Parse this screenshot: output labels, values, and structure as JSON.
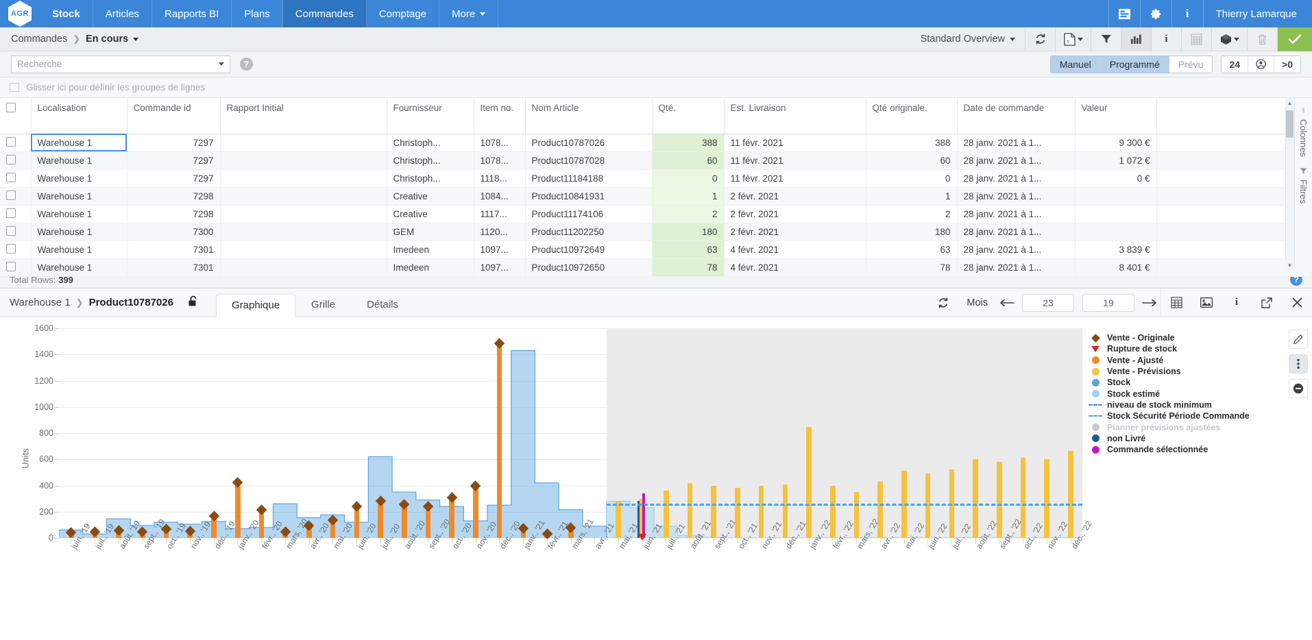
{
  "topnav": {
    "logo": "AGR",
    "items": [
      {
        "label": "Stock",
        "state": "bold"
      },
      {
        "label": "Articles",
        "state": "normal"
      },
      {
        "label": "Rapports BI",
        "state": "normal"
      },
      {
        "label": "Plans",
        "state": "normal"
      },
      {
        "label": "Commandes",
        "state": "active"
      },
      {
        "label": "Comptage",
        "state": "normal"
      },
      {
        "label": "More",
        "state": "caret"
      }
    ],
    "icons": [
      "list-icon",
      "gear-icon",
      "info-icon"
    ],
    "user": "Thierry Lamarque"
  },
  "breadcrumb": {
    "root": "Commandes",
    "current": "En cours",
    "overview": "Standard Overview",
    "tools": [
      "refresh-icon",
      "excel-export-icon",
      "filter-icon",
      "chart-icon",
      "info-icon",
      "calculator-icon",
      "cube-icon",
      "trash-icon",
      "confirm-icon"
    ]
  },
  "search": {
    "placeholder": "Recherche",
    "help": "?",
    "segments": [
      {
        "label": "Manuel",
        "on": true
      },
      {
        "label": "Programmé",
        "on": true
      },
      {
        "label": "Prévu",
        "on": false
      }
    ],
    "counter": "24",
    "user_icon": "user-icon",
    "threshold": ">0"
  },
  "grouping": {
    "hint": "Glisser ici pour définir les groupes de lignes"
  },
  "grid": {
    "columns": [
      "Localisation",
      "Commande id",
      "Rapport Initial",
      "Fournisseur",
      "Item no.",
      "Nom Article",
      "Qté.",
      "Est. Livraison",
      "Qté originale.",
      "Date de commande",
      "Valeur"
    ],
    "rows": [
      {
        "loc": "Warehouse 1",
        "cid": "7297",
        "rapport": "",
        "fourn": "Christoph...",
        "item": "1078...",
        "nom": "Product10787026",
        "qte": "388",
        "liv": "11 févr. 2021",
        "qteo": "388",
        "date": "28 janv. 2021 à 1...",
        "val": "9 300 €"
      },
      {
        "loc": "Warehouse 1",
        "cid": "7297",
        "rapport": "",
        "fourn": "Christoph...",
        "item": "1078...",
        "nom": "Product10787028",
        "qte": "60",
        "liv": "11 févr. 2021",
        "qteo": "60",
        "date": "28 janv. 2021 à 1...",
        "val": "1 072 €"
      },
      {
        "loc": "Warehouse 1",
        "cid": "7297",
        "rapport": "",
        "fourn": "Christoph...",
        "item": "1118...",
        "nom": "Product11184188",
        "qte": "0",
        "liv": "11 févr. 2021",
        "qteo": "0",
        "date": "28 janv. 2021 à 1...",
        "val": "0 €"
      },
      {
        "loc": "Warehouse 1",
        "cid": "7298",
        "rapport": "",
        "fourn": "Creative",
        "item": "1084...",
        "nom": "Product10841931",
        "qte": "1",
        "liv": "2 févr. 2021",
        "qteo": "1",
        "date": "28 janv. 2021 à 1...",
        "val": ""
      },
      {
        "loc": "Warehouse 1",
        "cid": "7298",
        "rapport": "",
        "fourn": "Creative",
        "item": "1117...",
        "nom": "Product11174106",
        "qte": "2",
        "liv": "2 févr. 2021",
        "qteo": "2",
        "date": "28 janv. 2021 à 1...",
        "val": ""
      },
      {
        "loc": "Warehouse 1",
        "cid": "7300",
        "rapport": "",
        "fourn": "GEM",
        "item": "1120...",
        "nom": "Product11202250",
        "qte": "180",
        "liv": "2 févr. 2021",
        "qteo": "180",
        "date": "28 janv. 2021 à 1...",
        "val": ""
      },
      {
        "loc": "Warehouse 1",
        "cid": "7301",
        "rapport": "",
        "fourn": "Imedeen",
        "item": "1097...",
        "nom": "Product10972649",
        "qte": "63",
        "liv": "4 févr. 2021",
        "qteo": "63",
        "date": "28 janv. 2021 à 1...",
        "val": "3 839 €"
      },
      {
        "loc": "Warehouse 1",
        "cid": "7301",
        "rapport": "",
        "fourn": "Imedeen",
        "item": "1097...",
        "nom": "Product10972650",
        "qte": "78",
        "liv": "4 févr. 2021",
        "qteo": "78",
        "date": "28 janv. 2021 à 1...",
        "val": "8 401 €"
      }
    ],
    "rail": [
      "Colonnes",
      "Filtres"
    ]
  },
  "totals": {
    "label": "Total Rows:",
    "value": "399"
  },
  "detail": {
    "warehouse": "Warehouse 1",
    "product": "Product10787026",
    "lock_icon": "unlock-icon",
    "tabs": [
      {
        "label": "Graphique",
        "on": true
      },
      {
        "label": "Grille",
        "on": false
      },
      {
        "label": "Détails",
        "on": false
      }
    ],
    "refresh_icon": "refresh-icon",
    "period_label": "Mois",
    "back_arrow": "arrow-left-icon",
    "months_back": "23",
    "months_fwd": "19",
    "fwd_arrow": "arrow-right-icon",
    "tools": [
      "grid-icon",
      "image-icon",
      "info-icon",
      "popout-icon",
      "close-icon"
    ],
    "side_tools": [
      "edit-icon",
      "more-icon",
      "minus-icon"
    ]
  },
  "chart_data": {
    "type": "bar",
    "title": "",
    "xlabel": "",
    "ylabel": "Units",
    "ylim": [
      0,
      1600
    ],
    "yticks": [
      0,
      200,
      400,
      600,
      800,
      1000,
      1200,
      1400,
      1600
    ],
    "grid": true,
    "legend_position": "right",
    "forecast_start_index": 23,
    "min_stock_level": 0,
    "safety_stock_order_period": 262,
    "categories": [
      "juin, '19",
      "juil., '19",
      "août, '19",
      "sept., '19",
      "oct., '19",
      "nov., '19",
      "déc., '19",
      "janv., '20",
      "févr., '20",
      "mars, '20",
      "avr., '20",
      "mai, '20",
      "juin, '20",
      "juil., '20",
      "août, '20",
      "sept., '20",
      "oct., '20",
      "nov., '20",
      "déc., '20",
      "janv., '21",
      "févr., '21",
      "mars, '21",
      "avr., '21",
      "mai, '21",
      "juin, '21",
      "juil., '21",
      "août, '21",
      "sept., '21",
      "oct., '21",
      "nov., '21",
      "déc., '21",
      "janv., '22",
      "févr., '22",
      "mars, '22",
      "avr., '22",
      "mai, '22",
      "juin, '22",
      "juil., '22",
      "août, '22",
      "sept., '22",
      "oct., '22",
      "nov., '22",
      "déc., '22"
    ],
    "series": [
      {
        "name": "Vente - Originale",
        "type": "diamond-marker",
        "color": "#8a4b12",
        "values": [
          35,
          40,
          52,
          38,
          62,
          45,
          160,
          415,
          205,
          40,
          85,
          130,
          235,
          275,
          250,
          232,
          300,
          390,
          1475,
          65,
          25,
          70,
          null,
          null,
          null,
          null,
          null,
          null,
          null,
          null,
          null,
          null,
          null,
          null,
          null,
          null,
          null,
          null,
          null,
          null,
          null,
          null,
          null
        ]
      },
      {
        "name": "Rupture de stock",
        "type": "triangle-marker",
        "color": "#e02020",
        "values": [
          null,
          null,
          null,
          null,
          null,
          null,
          null,
          null,
          null,
          null,
          null,
          null,
          null,
          null,
          null,
          null,
          null,
          null,
          null,
          null,
          null,
          null,
          null,
          null,
          5,
          null,
          null,
          null,
          null,
          null,
          null,
          null,
          null,
          null,
          null,
          null,
          null,
          null,
          null,
          null,
          null,
          null,
          null
        ]
      },
      {
        "name": "Vente - Ajusté",
        "type": "bar",
        "color": "#ef8a2b",
        "values": [
          35,
          40,
          52,
          38,
          62,
          45,
          160,
          415,
          205,
          40,
          85,
          130,
          235,
          275,
          250,
          232,
          300,
          390,
          1475,
          65,
          25,
          70,
          null,
          null,
          null,
          null,
          null,
          null,
          null,
          null,
          null,
          null,
          null,
          null,
          null,
          null,
          null,
          null,
          null,
          null,
          null,
          null,
          null
        ]
      },
      {
        "name": "Vente - Prévisions",
        "type": "bar",
        "color": "#f5c33b",
        "values": [
          null,
          null,
          null,
          null,
          null,
          null,
          null,
          null,
          null,
          null,
          null,
          null,
          null,
          null,
          null,
          null,
          null,
          null,
          null,
          null,
          null,
          null,
          null,
          275,
          300,
          360,
          420,
          395,
          380,
          400,
          410,
          845,
          400,
          350,
          430,
          510,
          490,
          525,
          600,
          580,
          610,
          600,
          665
        ]
      },
      {
        "name": "Stock",
        "type": "area-step",
        "color": "#5ba3e0",
        "values": [
          60,
          30,
          145,
          95,
          120,
          105,
          125,
          70,
          80,
          260,
          155,
          175,
          120,
          620,
          350,
          290,
          240,
          130,
          250,
          1430,
          420,
          215,
          90,
          null,
          null,
          null,
          null,
          null,
          null,
          null,
          null,
          null,
          null,
          null,
          null,
          null,
          null,
          null,
          null,
          null,
          null,
          null,
          null
        ]
      },
      {
        "name": "Stock estimé",
        "type": "area-step",
        "color": "#9fd2f2",
        "values": [
          null,
          null,
          null,
          null,
          null,
          null,
          null,
          null,
          null,
          null,
          null,
          null,
          null,
          null,
          null,
          null,
          null,
          null,
          null,
          null,
          null,
          null,
          null,
          280,
          230,
          90,
          20,
          5,
          0,
          0,
          0,
          0,
          0,
          0,
          0,
          0,
          0,
          0,
          0,
          0,
          0,
          0,
          0
        ]
      },
      {
        "name": "niveau de stock minimum",
        "type": "dashed-line",
        "color": "#3b86d8",
        "values": []
      },
      {
        "name": "Stock Sécurité Période Commande",
        "type": "dashed-line",
        "color": "#4aa3e8",
        "value": 262,
        "span": [
          23,
          42
        ]
      },
      {
        "name": "Planner prévisions ajustées",
        "type": "dot",
        "color": "#c6cacd",
        "muted": true,
        "values": []
      },
      {
        "name": "non Livré",
        "type": "bar",
        "color": "#1d5d96",
        "values": [
          null,
          null,
          null,
          null,
          null,
          null,
          null,
          null,
          null,
          null,
          null,
          null,
          null,
          null,
          null,
          null,
          null,
          null,
          null,
          null,
          null,
          null,
          null,
          null,
          285,
          null,
          null,
          null,
          null,
          null,
          null,
          null,
          null,
          null,
          null,
          null,
          null,
          null,
          null,
          null,
          null,
          null,
          null
        ]
      },
      {
        "name": "Commande sélectionnée",
        "type": "bar",
        "color": "#c318b8",
        "values": [
          null,
          null,
          null,
          null,
          null,
          null,
          null,
          null,
          null,
          null,
          null,
          null,
          null,
          null,
          null,
          null,
          null,
          null,
          null,
          null,
          null,
          null,
          null,
          null,
          340,
          null,
          null,
          null,
          null,
          null,
          null,
          null,
          null,
          null,
          null,
          null,
          null,
          null,
          null,
          null,
          null,
          null,
          null
        ]
      }
    ]
  }
}
